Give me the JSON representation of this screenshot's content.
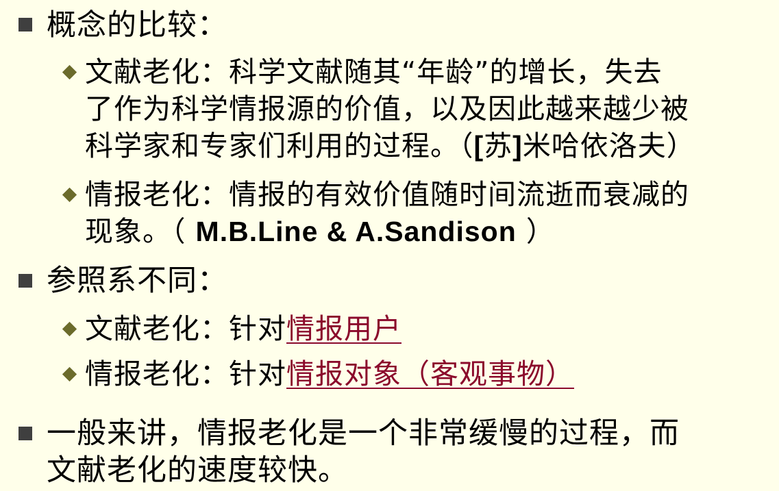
{
  "section1": {
    "heading": "概念的比较：",
    "item1": {
      "line1": "文献老化：科学文献随其“年龄”的增长，失去",
      "line2": "了作为科学情报源的价值，以及因此越来越少被",
      "line3_text": "科学家和专家们利用的过程。（",
      "line3_bracket_open": "[",
      "line3_country": "苏",
      "line3_bracket_close": "]",
      "line3_author": "米哈依洛夫）"
    },
    "item2": {
      "line1": "情报老化：情报的有效价值随时间流逝而衰减的",
      "line2_text": "现象。（",
      "line2_authors": "M.B.Line & A.Sandison",
      "line2_close": "）"
    }
  },
  "section2": {
    "heading": "参照系不同：",
    "item1": {
      "prefix": "文献老化：针对",
      "link": "情报用户"
    },
    "item2": {
      "prefix": "情报老化：针对",
      "link": "情报对象（客观事物）"
    }
  },
  "section3": {
    "line1": "一般来讲，情报老化是一个非常缓慢的过程，而",
    "line2": "文献老化的速度较快。"
  },
  "colors": {
    "background": "#ffffea",
    "square_bullet": "#3f3f3f",
    "diamond_bullet": "#6b6b2b",
    "link": "#8b0a2c"
  }
}
